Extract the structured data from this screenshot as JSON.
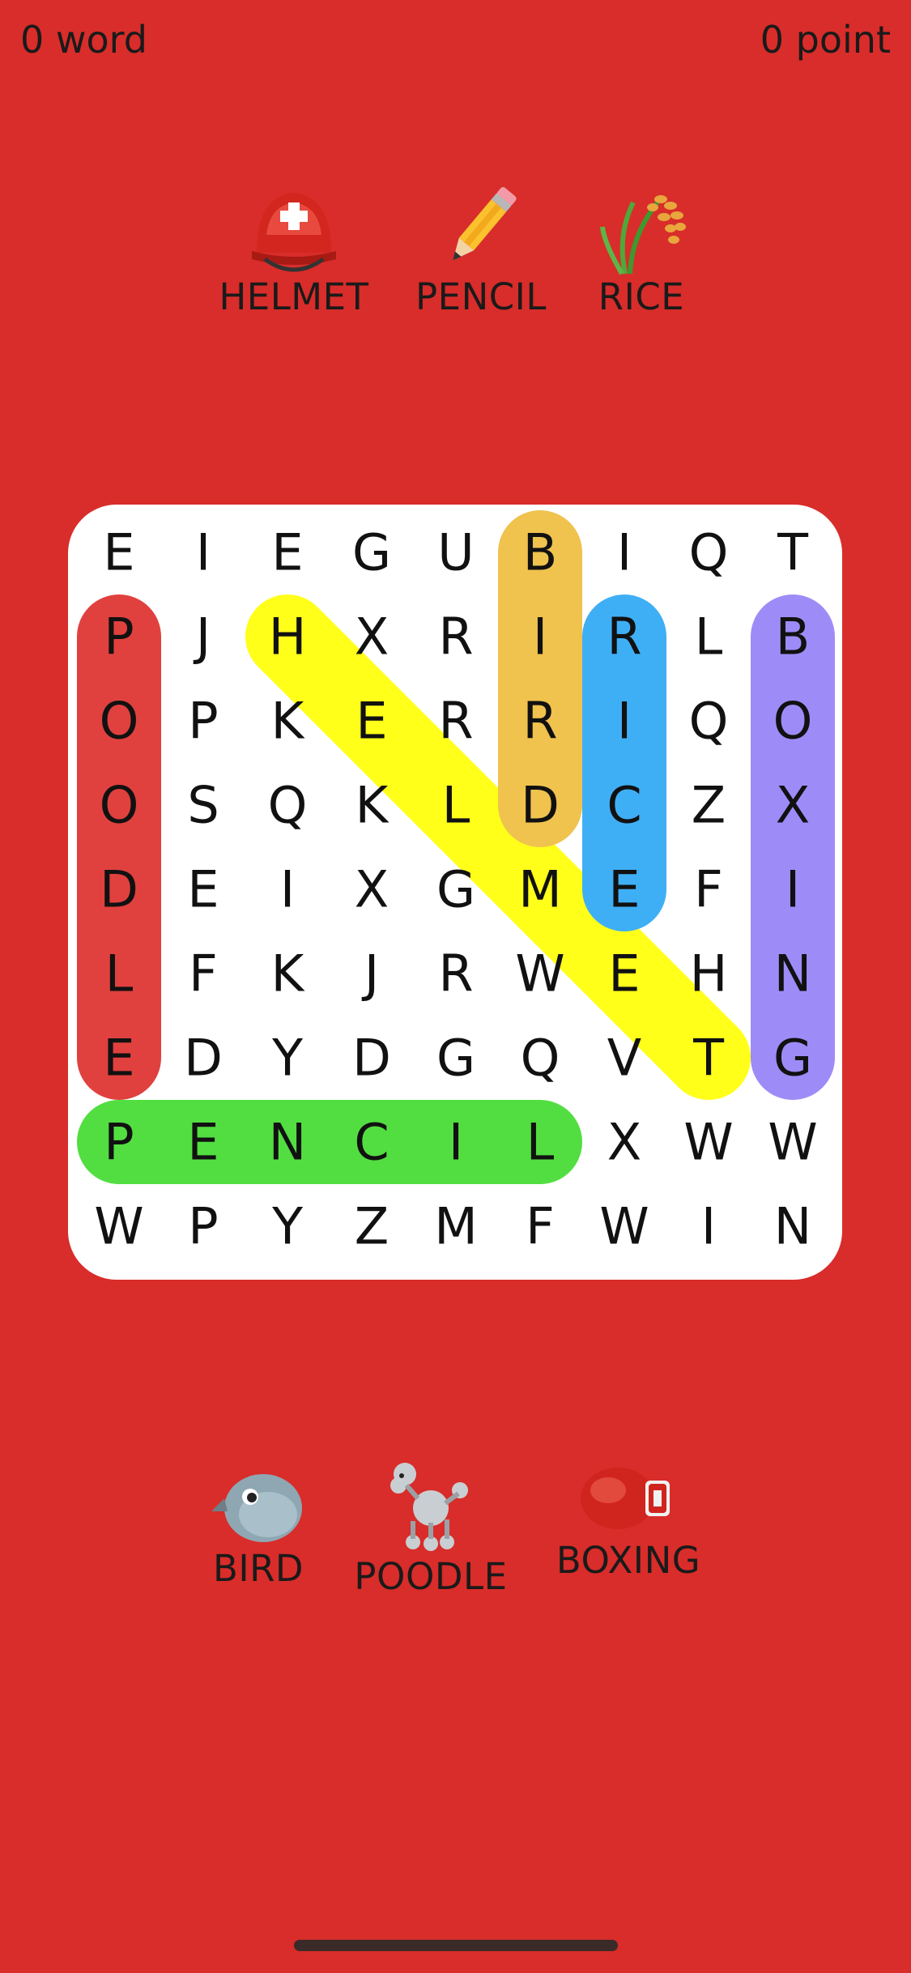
{
  "status": {
    "words": "0 word",
    "points": "0 point"
  },
  "top_clues": [
    {
      "label": "HELMET",
      "icon": "rescue-helmet-icon"
    },
    {
      "label": "PENCIL",
      "icon": "pencil-icon"
    },
    {
      "label": "RICE",
      "icon": "rice-plant-icon"
    }
  ],
  "bottom_clues": [
    {
      "label": "BIRD",
      "icon": "bird-icon"
    },
    {
      "label": "POODLE",
      "icon": "poodle-icon"
    },
    {
      "label": "BOXING",
      "icon": "boxing-glove-icon"
    }
  ],
  "grid": [
    [
      "E",
      "I",
      "E",
      "G",
      "U",
      "B",
      "I",
      "Q",
      "T"
    ],
    [
      "P",
      "J",
      "H",
      "X",
      "R",
      "I",
      "R",
      "L",
      "B"
    ],
    [
      "O",
      "P",
      "K",
      "E",
      "R",
      "R",
      "I",
      "Q",
      "O"
    ],
    [
      "O",
      "S",
      "Q",
      "K",
      "L",
      "D",
      "C",
      "Z",
      "X"
    ],
    [
      "D",
      "E",
      "I",
      "X",
      "G",
      "M",
      "E",
      "F",
      "I"
    ],
    [
      "L",
      "F",
      "K",
      "J",
      "R",
      "W",
      "E",
      "H",
      "N"
    ],
    [
      "E",
      "D",
      "Y",
      "D",
      "G",
      "Q",
      "V",
      "T",
      "G"
    ],
    [
      "P",
      "E",
      "N",
      "C",
      "I",
      "L",
      "X",
      "W",
      "W"
    ],
    [
      "W",
      "P",
      "Y",
      "Z",
      "M",
      "F",
      "W",
      "I",
      "N"
    ]
  ],
  "found_words": [
    {
      "word": "POODLE",
      "color": "#E0413E",
      "start": [
        1,
        0
      ],
      "end": [
        6,
        0
      ]
    },
    {
      "word": "HELMET",
      "color": "#FFFF1A",
      "start": [
        1,
        2
      ],
      "end": [
        6,
        7
      ]
    },
    {
      "word": "BIRD",
      "color": "#F0C24E",
      "start": [
        0,
        5
      ],
      "end": [
        3,
        5
      ]
    },
    {
      "word": "RICE",
      "color": "#3FAFF5",
      "start": [
        1,
        6
      ],
      "end": [
        4,
        6
      ]
    },
    {
      "word": "BOXING",
      "color": "#9D8CF7",
      "start": [
        1,
        8
      ],
      "end": [
        6,
        8
      ]
    },
    {
      "word": "PENCIL",
      "color": "#52DE41",
      "start": [
        7,
        0
      ],
      "end": [
        7,
        5
      ]
    }
  ]
}
